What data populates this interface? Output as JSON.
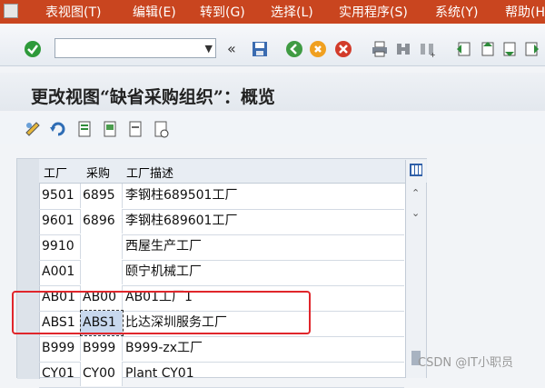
{
  "menu": {
    "items": [
      "表视图(T)",
      "编辑(E)",
      "转到(G)",
      "选择(L)",
      "实用程序(S)",
      "系统(Y)",
      "帮助(H)"
    ]
  },
  "command_field": {
    "value": ""
  },
  "window": {
    "title": "更改视图“缺省采购组织”：概览"
  },
  "table": {
    "headers": [
      "工厂",
      "采购",
      "工厂描述"
    ],
    "rows": [
      [
        "9501",
        "6895",
        "李钢柱689501工厂"
      ],
      [
        "9601",
        "6896",
        "李钢柱689601工厂"
      ],
      [
        "9910",
        "",
        "西屋生产工厂"
      ],
      [
        "A001",
        "",
        "颐宁机械工厂"
      ],
      [
        "AB01",
        "AB00",
        "AB01工厂1"
      ],
      [
        "ABS1",
        "ABS1",
        "比达深圳服务工厂"
      ],
      [
        "B999",
        "B999",
        "B999-zx工厂"
      ],
      [
        "CY01",
        "CY00",
        "Plant CY01"
      ]
    ]
  },
  "watermark": "CSDN @IT小职员",
  "colors": {
    "menubar": "#c9451f",
    "highlight": "#e0262b",
    "selection": "#c8d8ee"
  }
}
